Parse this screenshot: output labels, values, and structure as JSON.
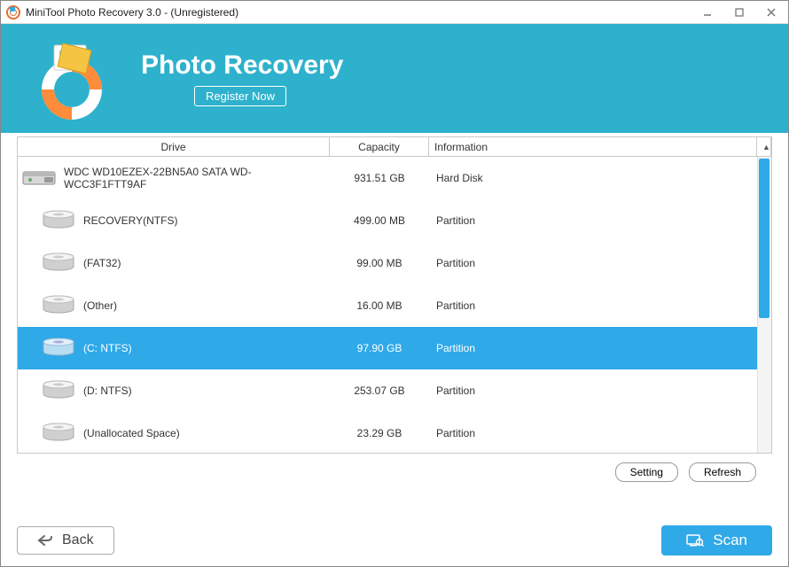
{
  "titlebar": {
    "text": "MiniTool Photo Recovery 3.0 - (Unregistered)"
  },
  "header": {
    "app_title": "Photo Recovery",
    "register_label": "Register Now"
  },
  "grid": {
    "headers": {
      "drive": "Drive",
      "capacity": "Capacity",
      "info": "Information"
    },
    "rows": [
      {
        "name": "WDC WD10EZEX-22BN5A0 SATA WD-WCC3F1FTT9AF",
        "capacity": "931.51 GB",
        "info": "Hard Disk",
        "type": "disk",
        "selected": false
      },
      {
        "name": "RECOVERY(NTFS)",
        "capacity": "499.00 MB",
        "info": "Partition",
        "type": "part",
        "selected": false
      },
      {
        "name": "(FAT32)",
        "capacity": "99.00 MB",
        "info": "Partition",
        "type": "part",
        "selected": false
      },
      {
        "name": "(Other)",
        "capacity": "16.00 MB",
        "info": "Partition",
        "type": "part",
        "selected": false
      },
      {
        "name": "(C: NTFS)",
        "capacity": "97.90 GB",
        "info": "Partition",
        "type": "part",
        "selected": true
      },
      {
        "name": "(D: NTFS)",
        "capacity": "253.07 GB",
        "info": "Partition",
        "type": "part",
        "selected": false
      },
      {
        "name": "(Unallocated Space)",
        "capacity": "23.29 GB",
        "info": "Partition",
        "type": "part",
        "selected": false
      }
    ]
  },
  "buttons": {
    "setting": "Setting",
    "refresh": "Refresh",
    "back": "Back",
    "scan": "Scan"
  }
}
